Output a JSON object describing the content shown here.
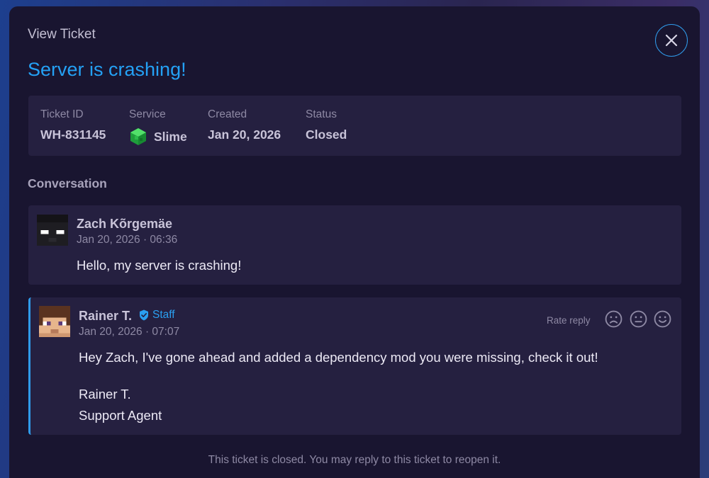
{
  "header": {
    "label": "View Ticket",
    "close_icon": "close-icon"
  },
  "ticket": {
    "title": "Server is crashing!",
    "fields": {
      "id_label": "Ticket ID",
      "id_value": "WH-831145",
      "service_label": "Service",
      "service_value": "Slime",
      "service_icon": "slime-block-icon",
      "created_label": "Created",
      "created_value": "Jan 20, 2026",
      "status_label": "Status",
      "status_value": "Closed"
    }
  },
  "conversation": {
    "label": "Conversation",
    "messages": [
      {
        "author": "Zach Kõrgemäe",
        "time": "Jan 20, 2026 · 06:36",
        "body": "Hello, my server is crashing!"
      },
      {
        "author": "Rainer T.",
        "badge": "Staff",
        "time": "Jan 20, 2026 · 07:07",
        "body": "Hey Zach, I've gone ahead and added a dependency mod you were missing, check it out!",
        "signature_name": "Rainer T.",
        "signature_role": "Support Agent",
        "rate_label": "Rate reply"
      }
    ]
  },
  "footer": {
    "note": "This ticket is closed. You may reply to this ticket to reopen it."
  },
  "colors": {
    "accent": "#24a1f5",
    "panel": "#191530",
    "card": "#252040"
  }
}
